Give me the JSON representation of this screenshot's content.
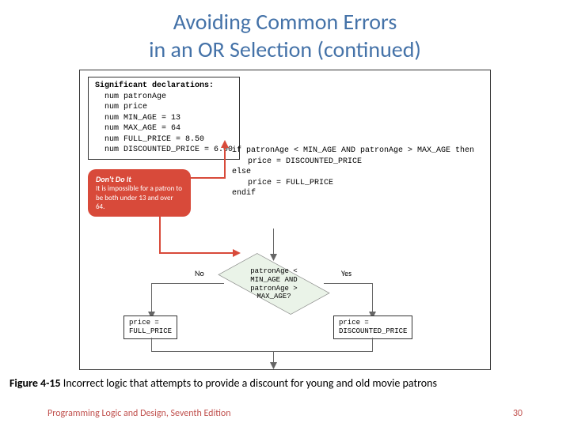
{
  "title": "Avoiding Common Errors\nin an OR Selection (continued)",
  "declarations": {
    "heading": "Significant declarations:",
    "lines": [
      "num patronAge",
      "num price",
      "num MIN_AGE = 13",
      "num MAX_AGE = 64",
      "num FULL_PRICE = 8.50",
      "num DISCOUNTED_PRICE = 6.00"
    ]
  },
  "code": {
    "l1": "if patronAge < MIN_AGE AND patronAge > MAX_AGE then",
    "l2": "price = DISCOUNTED_PRICE",
    "l3": "else",
    "l4": "price = FULL_PRICE",
    "l5": "endif"
  },
  "dont": {
    "title": "Don't Do It",
    "body": "It is impossible for a patron to be both under 13 and over 64."
  },
  "diamond": {
    "l1": "patronAge <",
    "l2": "MIN_AGE AND",
    "l3": "patronAge >",
    "l4": "MAX_AGE?"
  },
  "labels": {
    "no": "No",
    "yes": "Yes"
  },
  "rect_no": {
    "l1": "price =",
    "l2": "FULL_PRICE"
  },
  "rect_yes": {
    "l1": "price =",
    "l2": "DISCOUNTED_PRICE"
  },
  "caption": {
    "fig": "Figure 4-15",
    "text": " Incorrect logic that attempts to provide a discount for young and old movie patrons"
  },
  "footer": {
    "book": "Programming Logic and Design, Seventh Edition",
    "page": "30"
  }
}
